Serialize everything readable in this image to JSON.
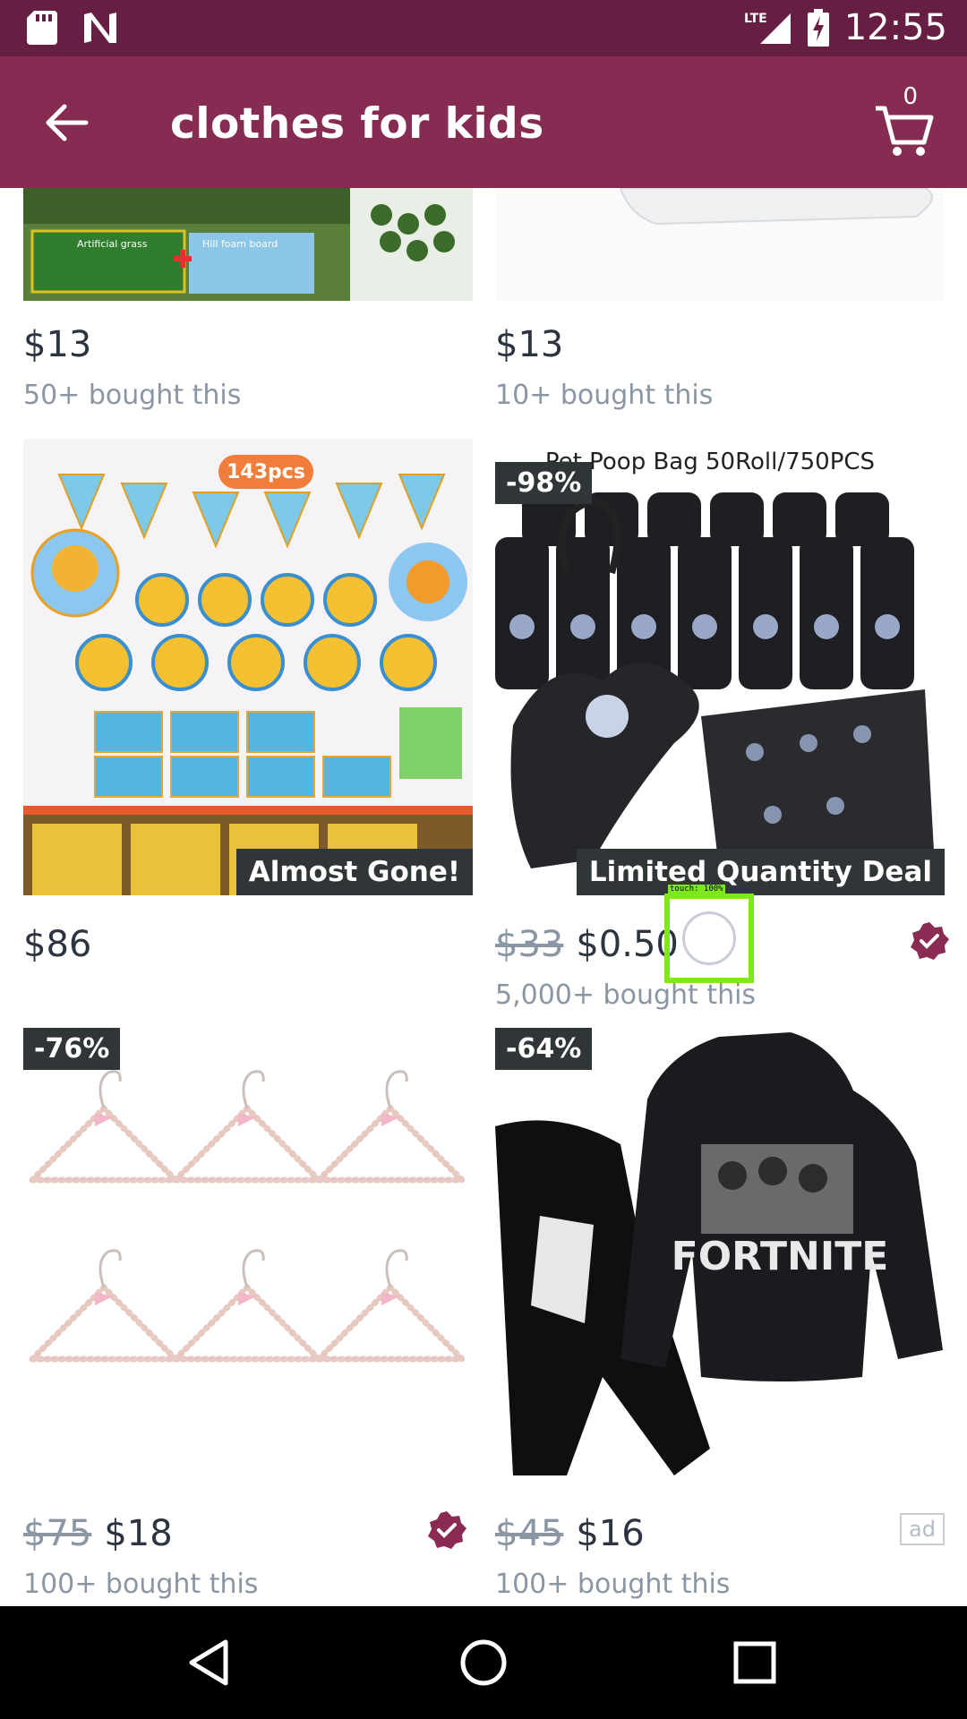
{
  "status_bar": {
    "time": "12:55",
    "network": "LTE"
  },
  "app_bar": {
    "title": "clothes for kids",
    "cart_count": "0"
  },
  "products": [
    {
      "price": "$13",
      "bought": "50+ bought this",
      "image_text": [
        "Artificial grass",
        "Hill foam board"
      ]
    },
    {
      "price": "$13",
      "bought": "10+ bought this"
    },
    {
      "price": "$86",
      "tag": "Almost Gone!",
      "image_text": "143pcs"
    },
    {
      "discount": "-98%",
      "old_price": "$33",
      "price": "$0.50",
      "bought": "5,000+ bought this",
      "tag": "Limited Quantity Deal",
      "image_text": "Pet Poop Bag 50Roll/750PCS"
    },
    {
      "discount": "-76%",
      "old_price": "$75",
      "price": "$18",
      "bought": "100+ bought this"
    },
    {
      "discount": "-64%",
      "old_price": "$45",
      "price": "$16",
      "bought": "100+ bought this",
      "ad_label": "ad",
      "image_text": "FORTNITE"
    }
  ],
  "touch_indicator": {
    "label": "touch: 100%"
  },
  "colors": {
    "status_bar": "#661e42",
    "app_bar": "#862b52",
    "verified": "#8a2b54"
  }
}
